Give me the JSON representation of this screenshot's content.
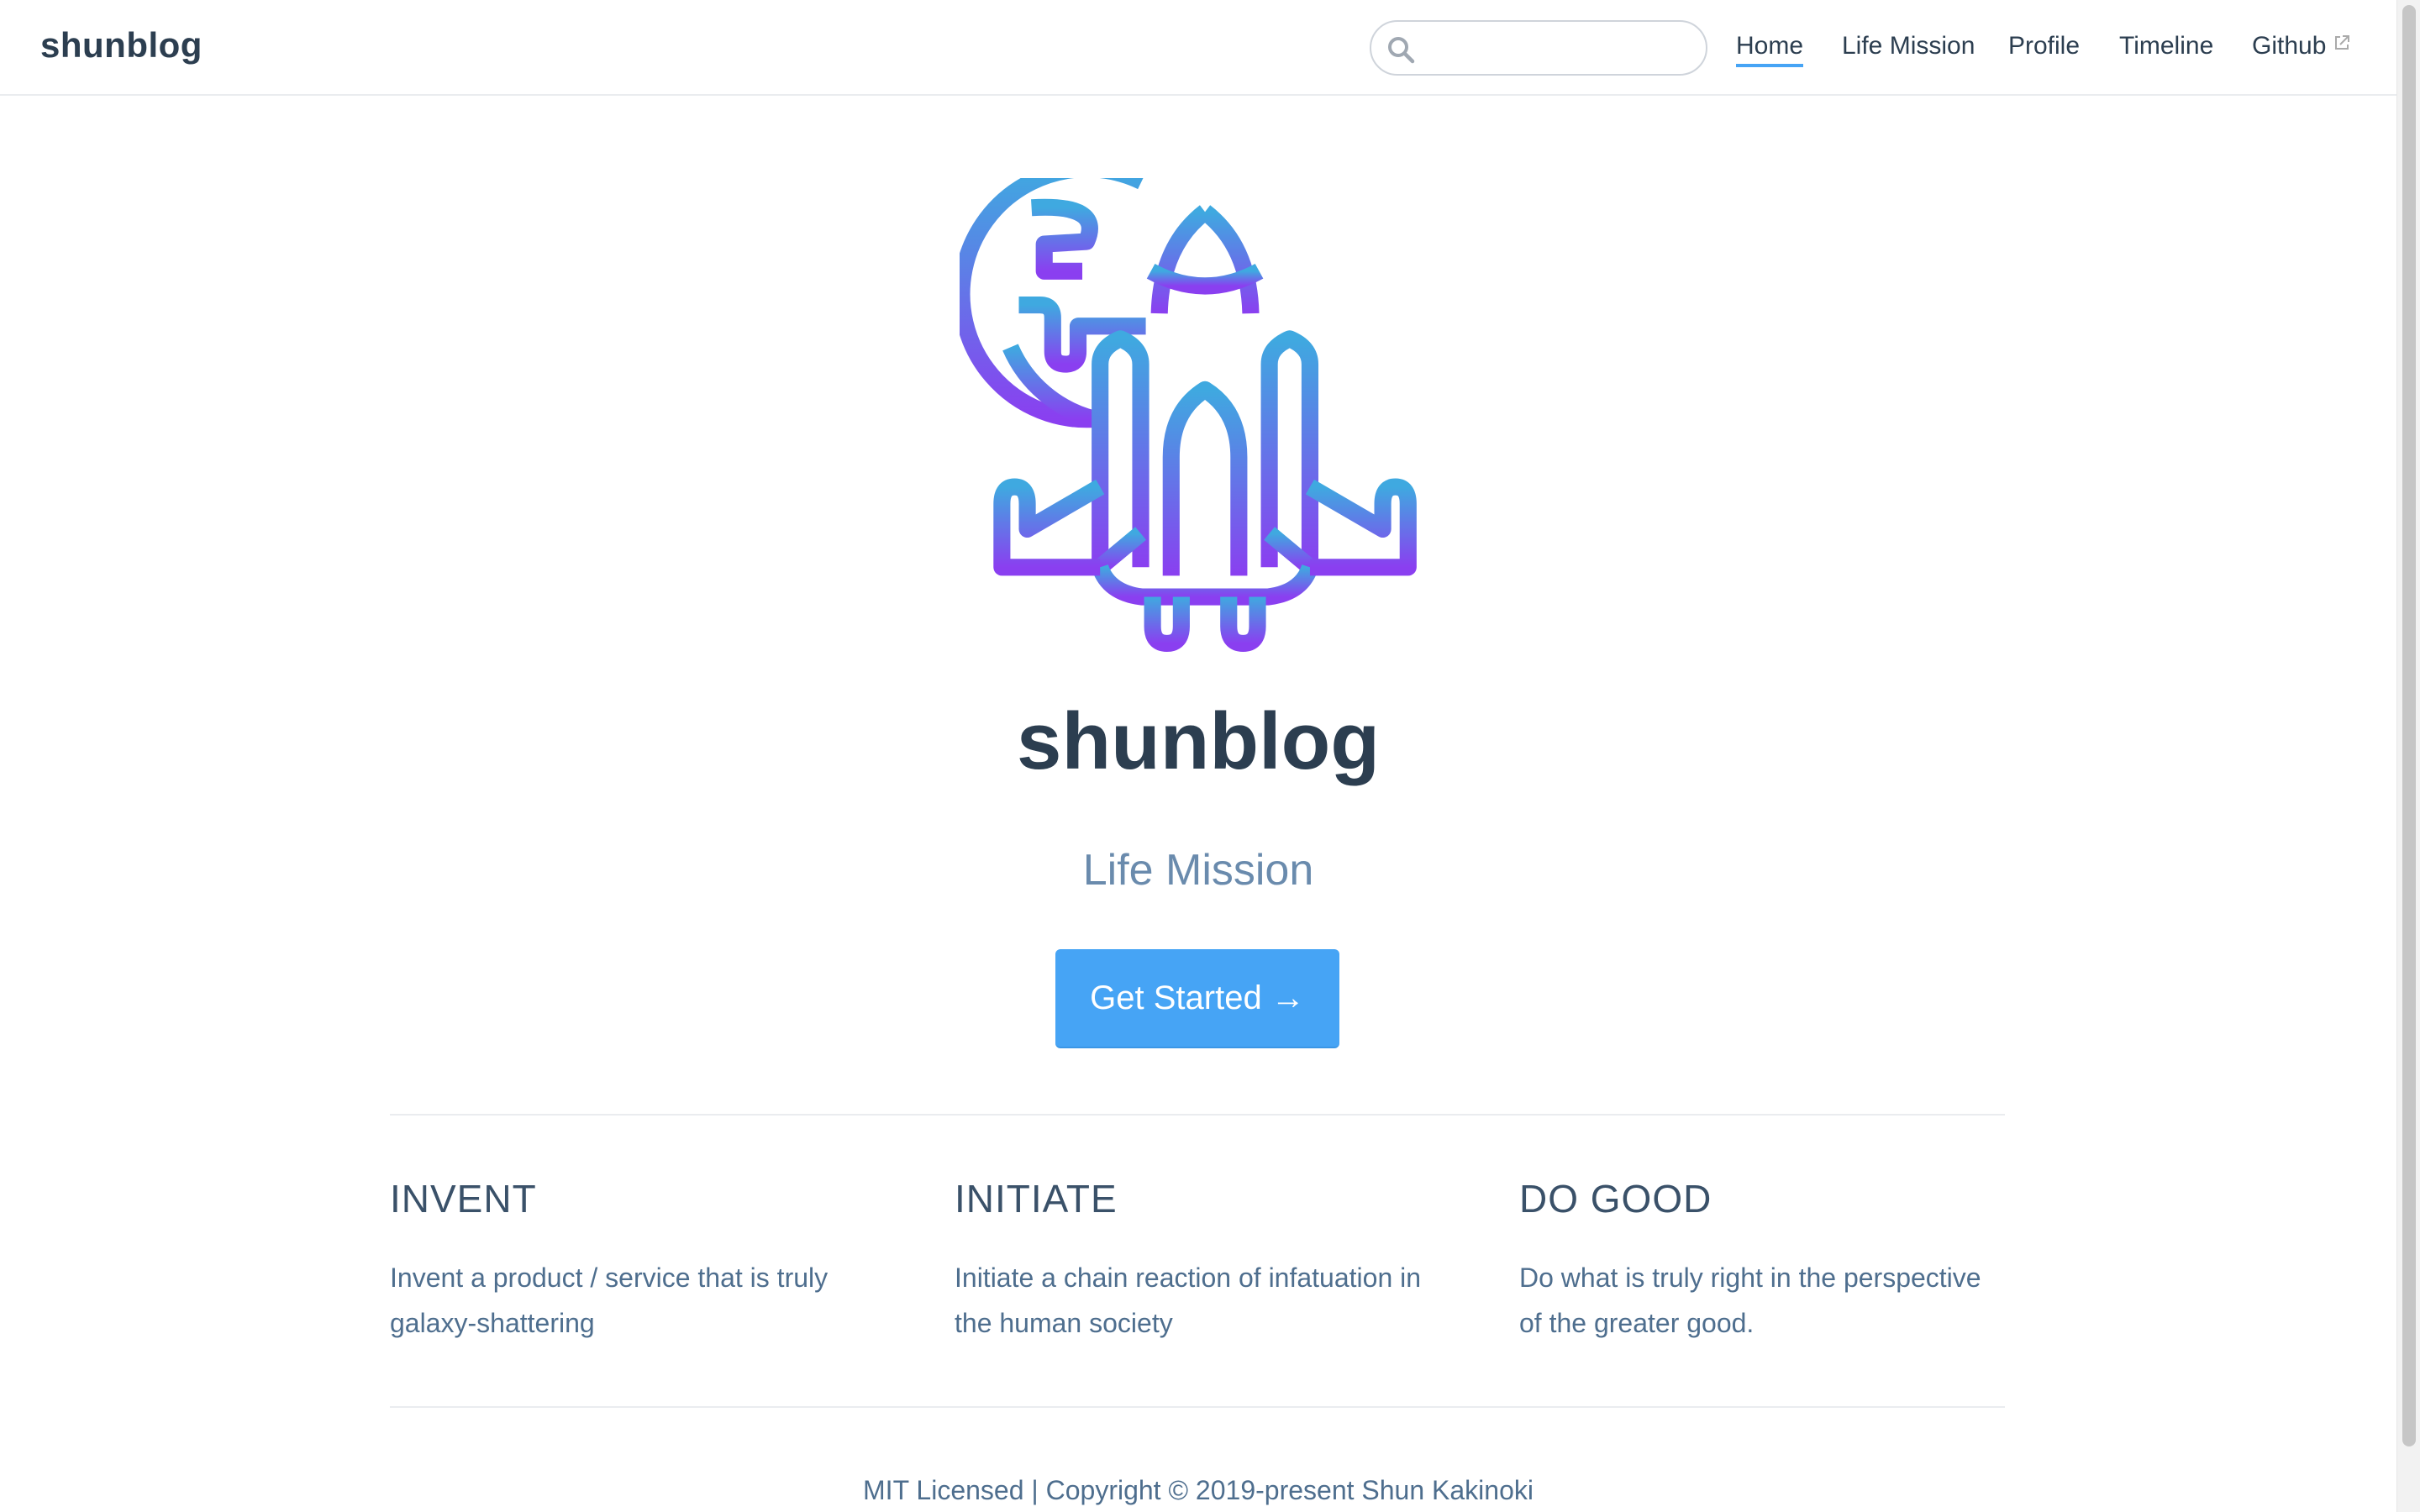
{
  "navbar": {
    "site_name": "shunblog",
    "search": {
      "value": "",
      "placeholder": ""
    },
    "links": [
      {
        "label": "Home",
        "active": true
      },
      {
        "label": "Life Mission",
        "active": false
      },
      {
        "label": "Profile",
        "active": false
      },
      {
        "label": "Timeline",
        "active": false
      },
      {
        "label": "Github",
        "active": false,
        "external": true
      }
    ]
  },
  "hero": {
    "logo_icon": "rocket-planet-icon",
    "title": "shunblog",
    "description": "Life Mission",
    "action_label": "Get Started →"
  },
  "features": [
    {
      "title": "INVENT",
      "details": "Invent a product / service that is truly galaxy-shattering"
    },
    {
      "title": "INITIATE",
      "details": "Initiate a chain reaction of infatuation in the human society"
    },
    {
      "title": "DO GOOD",
      "details": "Do what is truly right in the perspective of the greater good."
    }
  ],
  "footer": {
    "text": "MIT Licensed | Copyright © 2019-present Shun Kakinoki"
  },
  "colors": {
    "accent": "#46a4f5",
    "text": "#2c3e50",
    "muted": "#6a8bad",
    "gradient_top": "#3fa9e0",
    "gradient_bottom": "#8a3ff0"
  }
}
